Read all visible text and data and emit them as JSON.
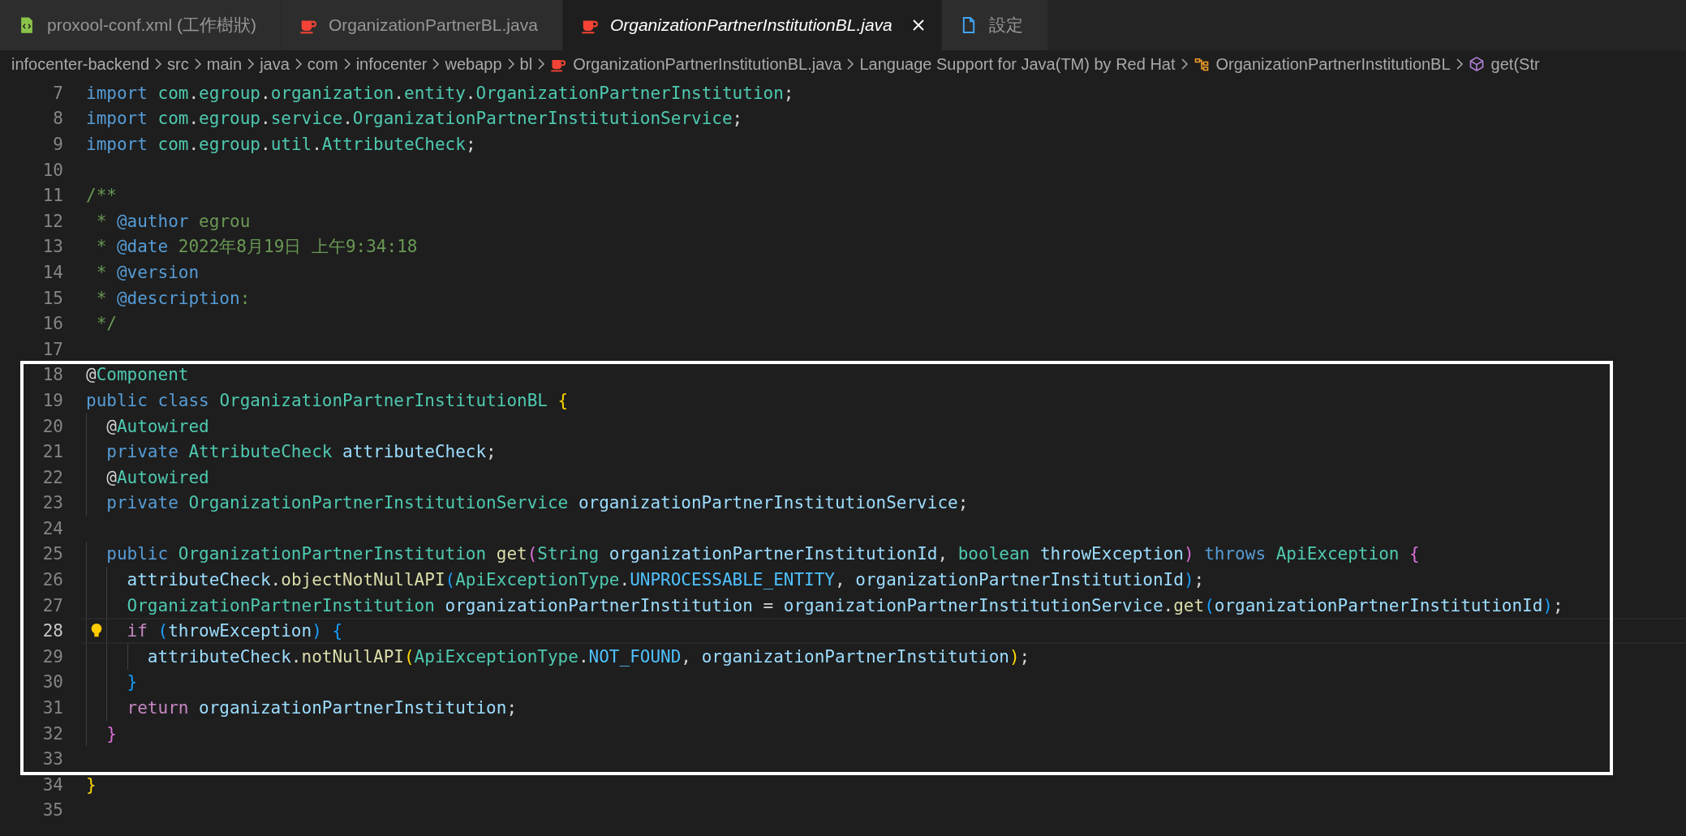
{
  "tabs": [
    {
      "label": "proxool-conf.xml (工作樹狀)",
      "kind": "xml",
      "selected": false,
      "preview": false
    },
    {
      "label": "OrganizationPartnerBL.java",
      "kind": "java",
      "selected": false,
      "preview": false
    },
    {
      "label": "OrganizationPartnerInstitutionBL.java",
      "kind": "java",
      "selected": true,
      "preview": true
    },
    {
      "label": "設定",
      "kind": "settings",
      "selected": false,
      "preview": false
    }
  ],
  "breadcrumb": [
    {
      "label": "infocenter-backend",
      "kind": "folder"
    },
    {
      "label": "src",
      "kind": "folder"
    },
    {
      "label": "main",
      "kind": "folder"
    },
    {
      "label": "java",
      "kind": "folder"
    },
    {
      "label": "com",
      "kind": "folder"
    },
    {
      "label": "infocenter",
      "kind": "folder"
    },
    {
      "label": "webapp",
      "kind": "folder"
    },
    {
      "label": "bl",
      "kind": "folder"
    },
    {
      "label": "OrganizationPartnerInstitutionBL.java",
      "kind": "java"
    },
    {
      "label": "Language Support for Java(TM) by Red Hat",
      "kind": "folder"
    },
    {
      "label": "OrganizationPartnerInstitutionBL",
      "kind": "class"
    },
    {
      "label": "get(Str",
      "kind": "method"
    }
  ],
  "code": {
    "before": [
      {
        "number": "7",
        "active": false,
        "tokens": [
          {
            "kind": "keyword",
            "text": "import "
          },
          {
            "kind": "type",
            "text": "com"
          },
          {
            "kind": "plain",
            "text": "."
          },
          {
            "kind": "type",
            "text": "egroup"
          },
          {
            "kind": "plain",
            "text": "."
          },
          {
            "kind": "type",
            "text": "organization"
          },
          {
            "kind": "plain",
            "text": "."
          },
          {
            "kind": "type",
            "text": "entity"
          },
          {
            "kind": "plain",
            "text": "."
          },
          {
            "kind": "type",
            "text": "OrganizationPartnerInstitution"
          },
          {
            "kind": "plain",
            "text": ";"
          }
        ]
      },
      {
        "number": "8",
        "active": false,
        "tokens": [
          {
            "kind": "keyword",
            "text": "import "
          },
          {
            "kind": "type",
            "text": "com"
          },
          {
            "kind": "plain",
            "text": "."
          },
          {
            "kind": "type",
            "text": "egroup"
          },
          {
            "kind": "plain",
            "text": "."
          },
          {
            "kind": "type",
            "text": "service"
          },
          {
            "kind": "plain",
            "text": "."
          },
          {
            "kind": "type",
            "text": "OrganizationPartnerInstitutionService"
          },
          {
            "kind": "plain",
            "text": ";"
          }
        ]
      },
      {
        "number": "9",
        "active": false,
        "tokens": [
          {
            "kind": "keyword",
            "text": "import "
          },
          {
            "kind": "type",
            "text": "com"
          },
          {
            "kind": "plain",
            "text": "."
          },
          {
            "kind": "type",
            "text": "egroup"
          },
          {
            "kind": "plain",
            "text": "."
          },
          {
            "kind": "type",
            "text": "util"
          },
          {
            "kind": "plain",
            "text": "."
          },
          {
            "kind": "type",
            "text": "AttributeCheck"
          },
          {
            "kind": "plain",
            "text": ";"
          }
        ]
      },
      {
        "number": "10",
        "active": false
      },
      {
        "number": "11",
        "active": false,
        "tokens": [
          {
            "kind": "comment",
            "text": "/**"
          }
        ]
      },
      {
        "number": "12",
        "active": false,
        "tokens": [
          {
            "kind": "comment",
            "text": " * "
          },
          {
            "kind": "tag",
            "text": "@author"
          },
          {
            "kind": "comment",
            "text": " egrou"
          }
        ]
      },
      {
        "number": "13",
        "active": false,
        "tokens": [
          {
            "kind": "comment",
            "text": " * "
          },
          {
            "kind": "tag",
            "text": "@date"
          },
          {
            "kind": "comment",
            "text": " 2022年8月19日 上午9:34:18"
          }
        ]
      },
      {
        "number": "14",
        "active": false,
        "tokens": [
          {
            "kind": "comment",
            "text": " * "
          },
          {
            "kind": "tag",
            "text": "@version"
          }
        ]
      },
      {
        "number": "15",
        "active": false,
        "tokens": [
          {
            "kind": "comment",
            "text": " * "
          },
          {
            "kind": "tag",
            "text": "@description"
          },
          {
            "kind": "comment",
            "text": ":"
          }
        ]
      },
      {
        "number": "16",
        "active": false,
        "tokens": [
          {
            "kind": "comment",
            "text": " */"
          }
        ]
      },
      {
        "number": "17",
        "active": false
      }
    ],
    "highlighted": [
      {
        "number": "18",
        "active": false,
        "tokens": [
          {
            "kind": "plain",
            "text": "@"
          },
          {
            "kind": "type",
            "text": "Component"
          }
        ]
      },
      {
        "number": "19",
        "active": false,
        "tokens": [
          {
            "kind": "keyword",
            "text": "public class "
          },
          {
            "kind": "type",
            "text": "OrganizationPartnerInstitutionBL "
          },
          {
            "kind": "brace1",
            "text": "{"
          }
        ]
      },
      {
        "number": "20",
        "active": false,
        "tokens": [
          {
            "kind": "plain",
            "text": "  @"
          },
          {
            "kind": "type",
            "text": "Autowired"
          }
        ]
      },
      {
        "number": "21",
        "active": false,
        "tokens": [
          {
            "kind": "keyword",
            "text": "  private "
          },
          {
            "kind": "type",
            "text": "AttributeCheck "
          },
          {
            "kind": "variable",
            "text": "attributeCheck"
          },
          {
            "kind": "plain",
            "text": ";"
          }
        ]
      },
      {
        "number": "22",
        "active": false,
        "tokens": [
          {
            "kind": "plain",
            "text": "  @"
          },
          {
            "kind": "type",
            "text": "Autowired"
          }
        ]
      },
      {
        "number": "23",
        "active": false,
        "tokens": [
          {
            "kind": "keyword",
            "text": "  private "
          },
          {
            "kind": "type",
            "text": "OrganizationPartnerInstitutionService "
          },
          {
            "kind": "variable",
            "text": "organizationPartnerInstitutionService"
          },
          {
            "kind": "plain",
            "text": ";"
          }
        ]
      },
      {
        "number": "24",
        "active": false
      },
      {
        "number": "25",
        "active": false,
        "tokens": [
          {
            "kind": "keyword",
            "text": "  public "
          },
          {
            "kind": "type",
            "text": "OrganizationPartnerInstitution "
          },
          {
            "kind": "function",
            "text": "get"
          },
          {
            "kind": "brace2",
            "text": "("
          },
          {
            "kind": "type",
            "text": "String "
          },
          {
            "kind": "variable",
            "text": "organizationPartnerInstitutionId"
          },
          {
            "kind": "plain",
            "text": ", "
          },
          {
            "kind": "type",
            "text": "boolean "
          },
          {
            "kind": "variable",
            "text": "throwException"
          },
          {
            "kind": "brace2",
            "text": ") "
          },
          {
            "kind": "keyword",
            "text": "throws "
          },
          {
            "kind": "type",
            "text": "ApiException "
          },
          {
            "kind": "brace2",
            "text": "{"
          }
        ]
      },
      {
        "number": "26",
        "active": false,
        "tokens": [
          {
            "kind": "variable",
            "text": "    attributeCheck"
          },
          {
            "kind": "plain",
            "text": "."
          },
          {
            "kind": "function",
            "text": "objectNotNullAPI"
          },
          {
            "kind": "brace3",
            "text": "("
          },
          {
            "kind": "type",
            "text": "ApiExceptionType"
          },
          {
            "kind": "plain",
            "text": "."
          },
          {
            "kind": "constant",
            "text": "UNPROCESSABLE_ENTITY"
          },
          {
            "kind": "plain",
            "text": ", "
          },
          {
            "kind": "variable",
            "text": "organizationPartnerInstitutionId"
          },
          {
            "kind": "brace3",
            "text": ")"
          },
          {
            "kind": "plain",
            "text": ";"
          }
        ]
      },
      {
        "number": "27",
        "active": false,
        "tokens": [
          {
            "kind": "type",
            "text": "    OrganizationPartnerInstitution "
          },
          {
            "kind": "variable",
            "text": "organizationPartnerInstitution"
          },
          {
            "kind": "plain",
            "text": " = "
          },
          {
            "kind": "variable",
            "text": "organizationPartnerInstitutionService"
          },
          {
            "kind": "plain",
            "text": "."
          },
          {
            "kind": "function",
            "text": "get"
          },
          {
            "kind": "brace3",
            "text": "("
          },
          {
            "kind": "variable",
            "text": "organizationPartnerInstitutionId"
          },
          {
            "kind": "brace3",
            "text": ")"
          },
          {
            "kind": "plain",
            "text": ";"
          }
        ]
      },
      {
        "number": "28",
        "active": true,
        "tokens": [
          {
            "kind": "control",
            "text": "    if "
          },
          {
            "kind": "brace3",
            "text": "("
          },
          {
            "kind": "variable",
            "text": "throwException"
          },
          {
            "kind": "brace3",
            "text": ") {"
          }
        ]
      },
      {
        "number": "29",
        "active": false,
        "tokens": [
          {
            "kind": "variable",
            "text": "      attributeCheck"
          },
          {
            "kind": "plain",
            "text": "."
          },
          {
            "kind": "function",
            "text": "notNullAPI"
          },
          {
            "kind": "brace1",
            "text": "("
          },
          {
            "kind": "type",
            "text": "ApiExceptionType"
          },
          {
            "kind": "plain",
            "text": "."
          },
          {
            "kind": "constant",
            "text": "NOT_FOUND"
          },
          {
            "kind": "plain",
            "text": ", "
          },
          {
            "kind": "variable",
            "text": "organizationPartnerInstitution"
          },
          {
            "kind": "brace1",
            "text": ")"
          },
          {
            "kind": "plain",
            "text": ";"
          }
        ]
      },
      {
        "number": "30",
        "active": false,
        "tokens": [
          {
            "kind": "brace3",
            "text": "    }"
          }
        ]
      },
      {
        "number": "31",
        "active": false,
        "tokens": [
          {
            "kind": "control",
            "text": "    return "
          },
          {
            "kind": "variable",
            "text": "organizationPartnerInstitution"
          },
          {
            "kind": "plain",
            "text": ";"
          }
        ]
      },
      {
        "number": "32",
        "active": false,
        "tokens": [
          {
            "kind": "brace2",
            "text": "  }"
          }
        ]
      },
      {
        "number": "33",
        "active": false
      }
    ],
    "after": [
      {
        "number": "34",
        "active": false,
        "tokens": [
          {
            "kind": "brace1",
            "text": "}"
          }
        ]
      },
      {
        "number": "35",
        "active": false
      }
    ]
  }
}
